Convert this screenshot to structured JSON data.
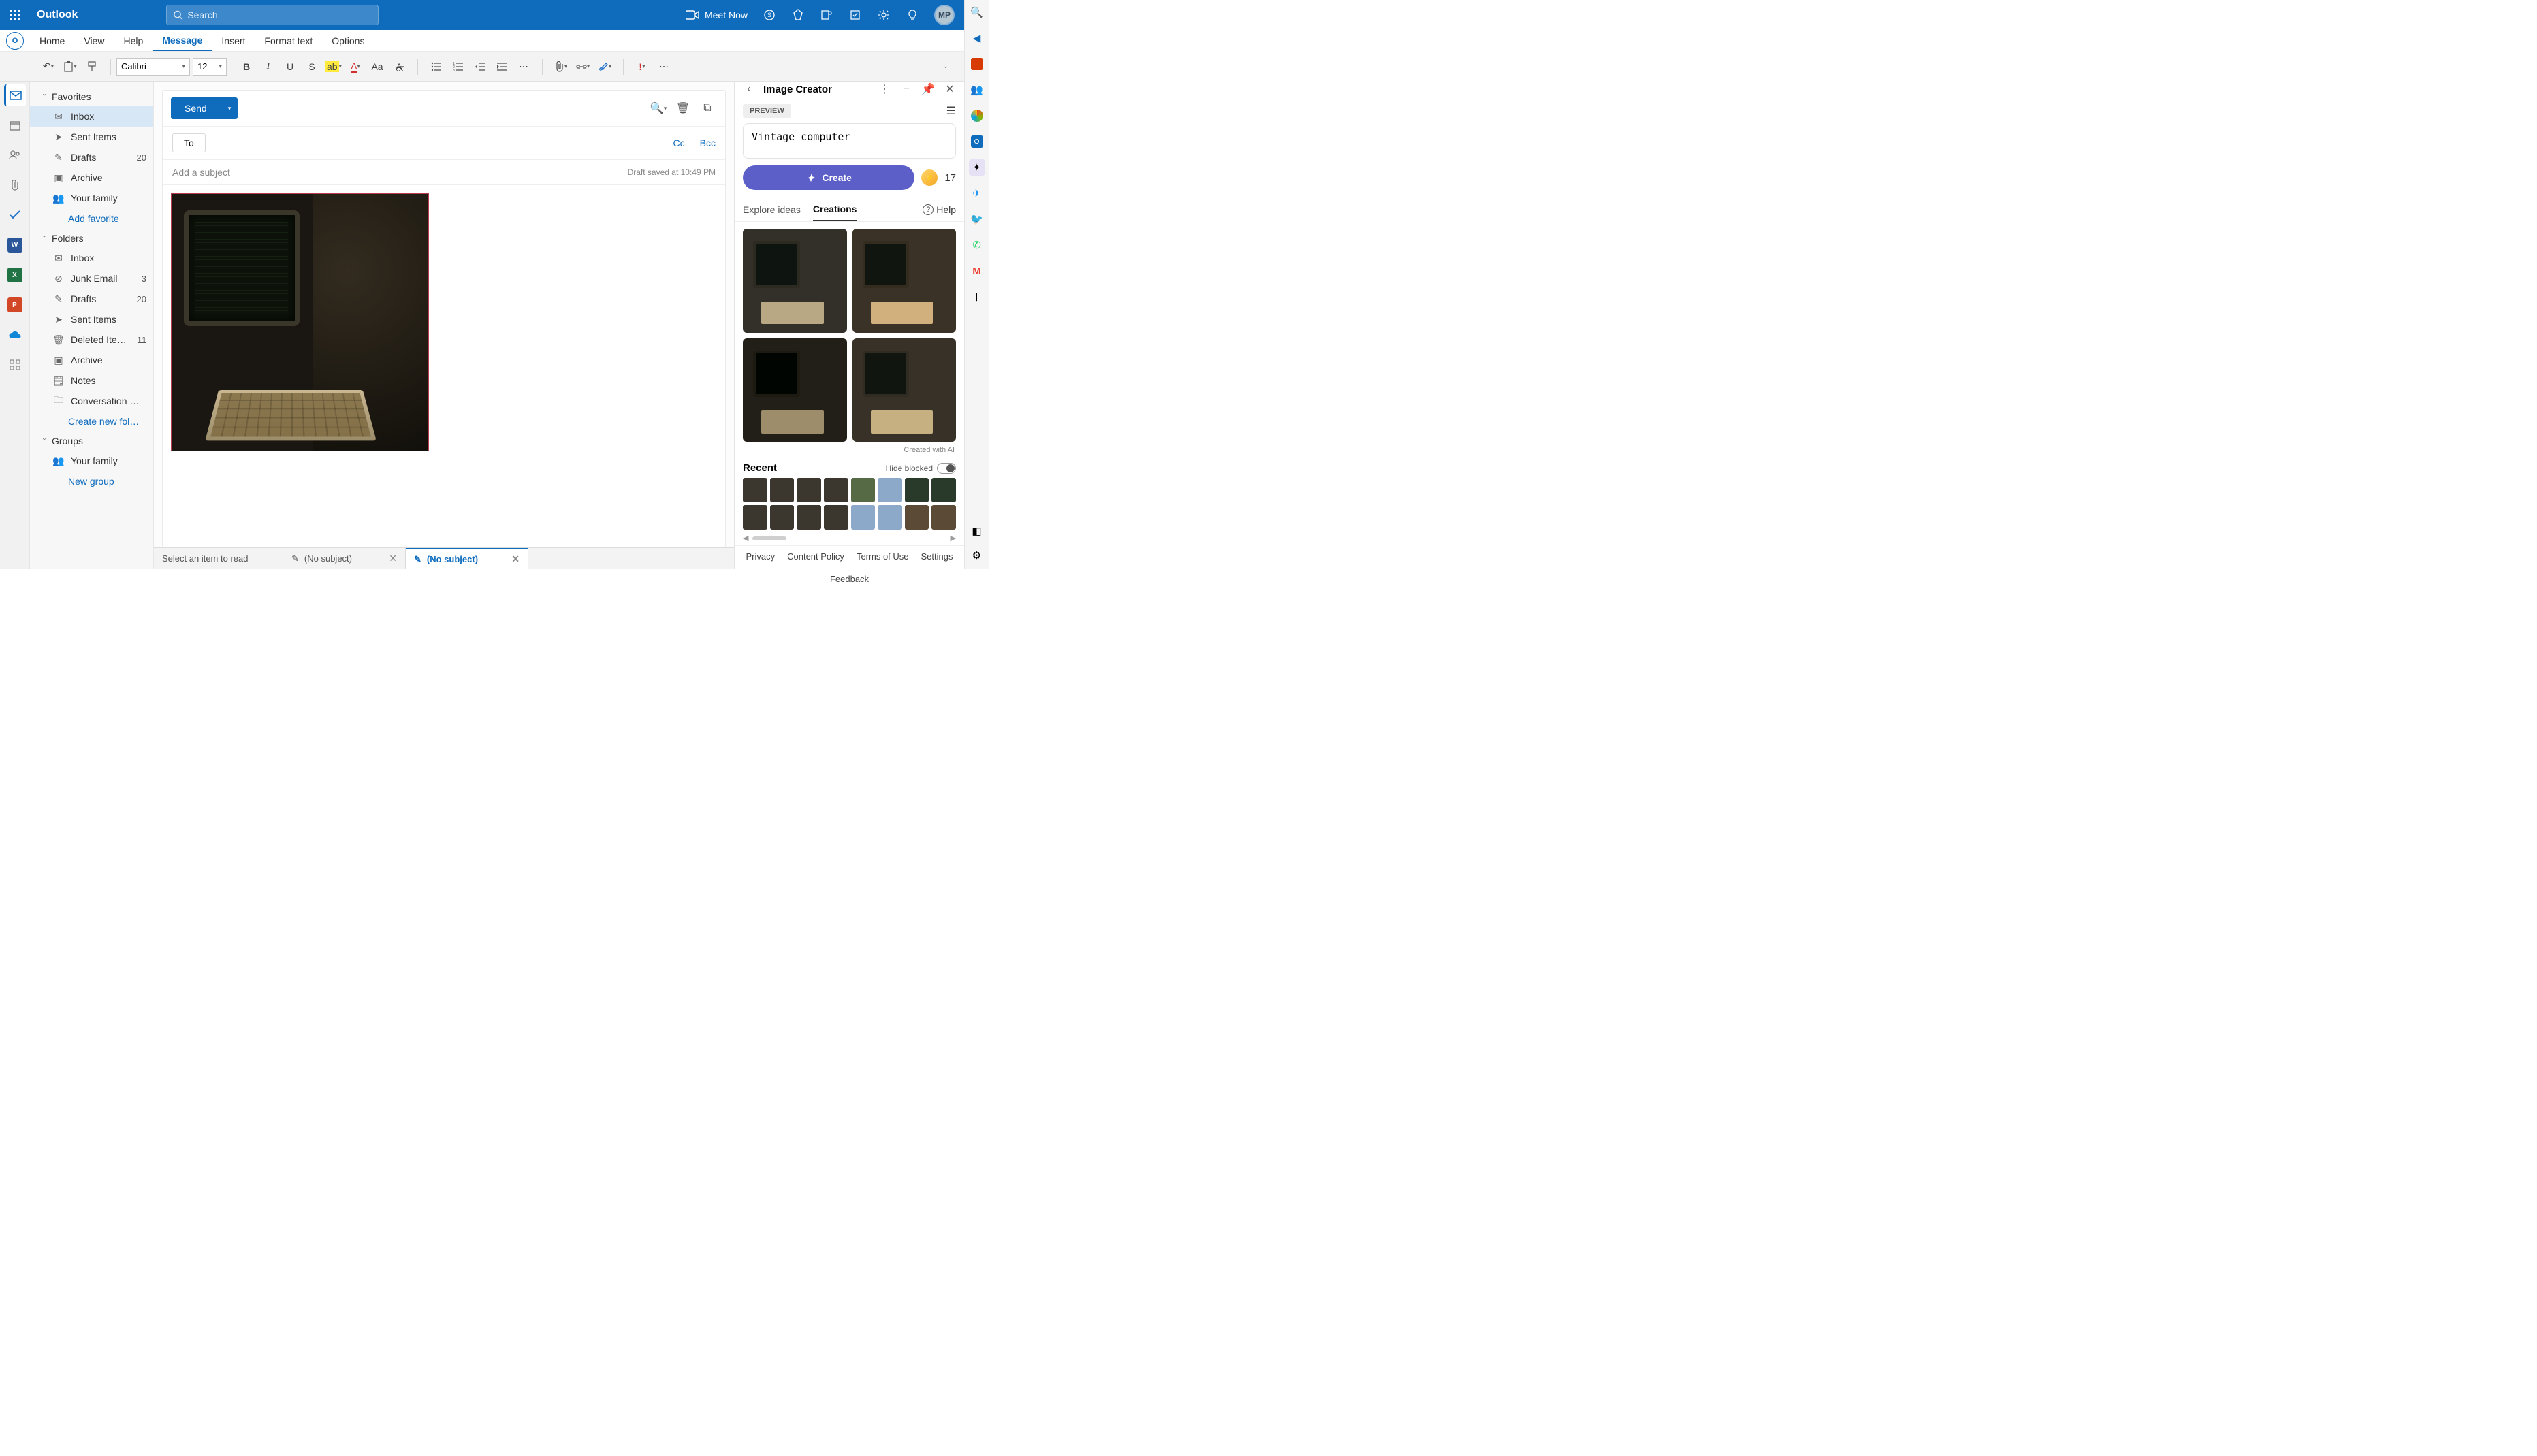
{
  "app": {
    "title": "Outlook",
    "avatar": "MP"
  },
  "search": {
    "placeholder": "Search"
  },
  "meet_now": "Meet Now",
  "ribbon": {
    "tabs": {
      "home": "Home",
      "view": "View",
      "help": "Help",
      "message": "Message",
      "insert": "Insert",
      "format": "Format text",
      "options": "Options"
    }
  },
  "toolbar": {
    "font": "Calibri",
    "size": "12"
  },
  "folders": {
    "favorites": "Favorites",
    "inbox": "Inbox",
    "sent": "Sent Items",
    "drafts": "Drafts",
    "drafts_count": "20",
    "archive": "Archive",
    "your_family": "Your family",
    "add_favorite": "Add favorite",
    "folders_header": "Folders",
    "junk": "Junk Email",
    "junk_count": "3",
    "drafts2_count": "20",
    "deleted": "Deleted Ite…",
    "deleted_count": "11",
    "notes": "Notes",
    "conversation": "Conversation …",
    "create_folder": "Create new fol…",
    "groups": "Groups",
    "new_group": "New group"
  },
  "compose": {
    "send": "Send",
    "to": "To",
    "cc": "Cc",
    "bcc": "Bcc",
    "subject_placeholder": "Add a subject",
    "saved": "Draft saved at 10:49 PM"
  },
  "bottom_tabs": {
    "select": "Select an item to read",
    "tab1": "(No subject)",
    "tab2": "(No subject)"
  },
  "creator": {
    "title": "Image Creator",
    "preview": "PREVIEW",
    "prompt": "Vintage computer",
    "create": "Create",
    "coins": "17",
    "tabs": {
      "explore": "Explore ideas",
      "creations": "Creations"
    },
    "help": "Help",
    "ai_note": "Created with AI",
    "recent": "Recent",
    "hide_blocked": "Hide blocked",
    "footer": {
      "privacy": "Privacy",
      "policy": "Content Policy",
      "terms": "Terms of Use",
      "settings": "Settings",
      "feedback": "Feedback"
    }
  }
}
